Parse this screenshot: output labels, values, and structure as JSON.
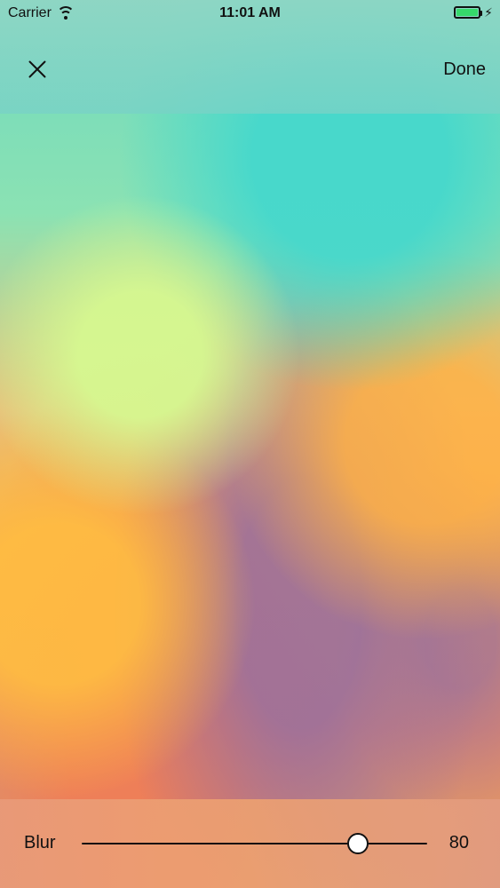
{
  "status_bar": {
    "carrier": "Carrier",
    "time": "11:01 AM",
    "battery_level": 1.0,
    "battery_color": "#36d96b"
  },
  "navigation": {
    "close_icon": "close-icon",
    "done_label": "Done"
  },
  "blur_control": {
    "label": "Blur",
    "value": "80",
    "slider_value": 0.8
  }
}
